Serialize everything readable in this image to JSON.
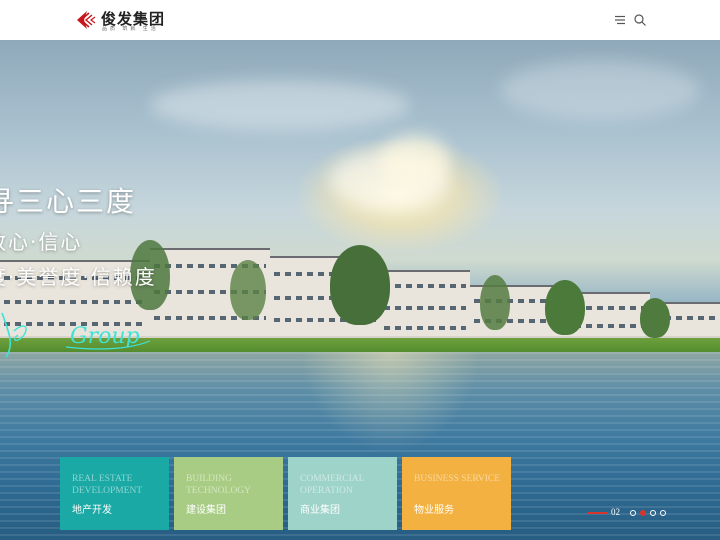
{
  "header": {
    "logo_name": "俊发集团",
    "logo_slogan": "品质 筑就 生活",
    "menu_icon": "menu-icon",
    "search_icon": "search-icon"
  },
  "hero": {
    "slogan_line1": "寻三心三度",
    "slogan_line2": "致心·信心",
    "slogan_line3": "度·美誉度·信赖度",
    "signature_text": "Group"
  },
  "tiles": [
    {
      "en": "REAL ESTATE DEVELOPMENT",
      "cn": "地产开发",
      "color": "#1aa9a4"
    },
    {
      "en": "BUILDING TECHNOLOGY",
      "cn": "建设集团",
      "color": "#a8cc83"
    },
    {
      "en": "COMMERCIAL OPERATION",
      "cn": "商业集团",
      "color": "#9ed3c9"
    },
    {
      "en": "BUSINESS SERVICE",
      "cn": "物业服务",
      "color": "#f2b140"
    }
  ],
  "pager": {
    "current": "02",
    "accent": "#d9342b"
  }
}
